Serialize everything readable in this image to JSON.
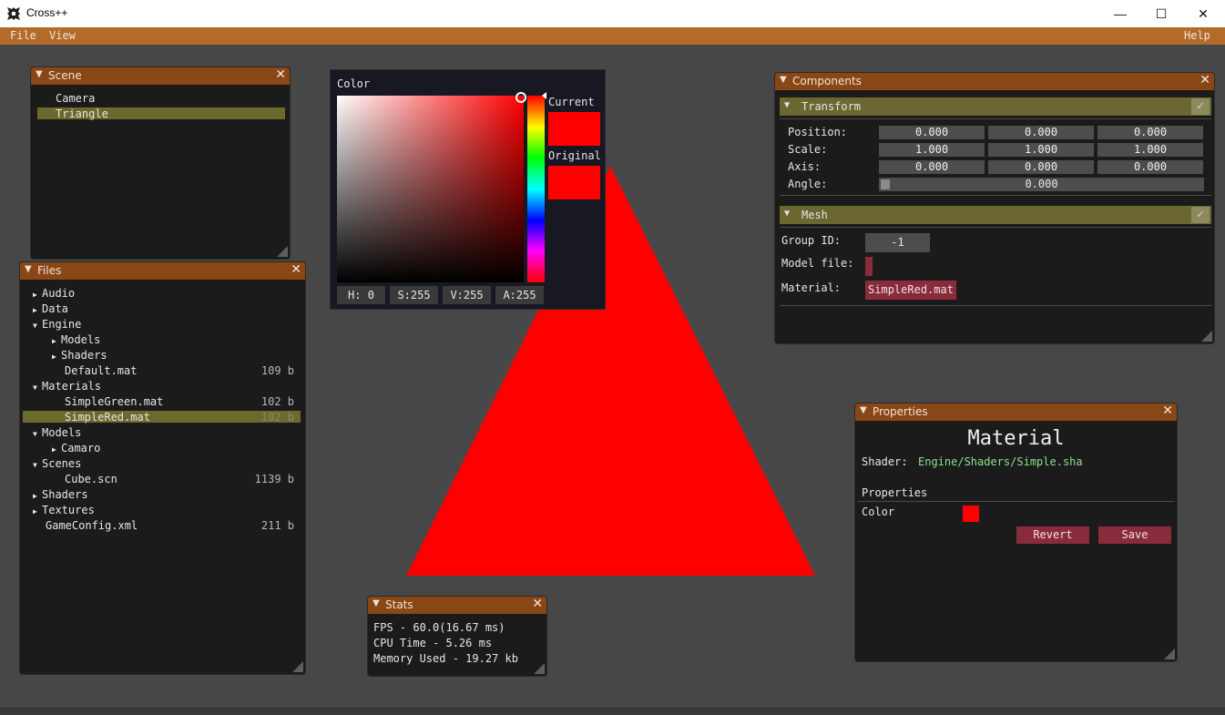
{
  "window": {
    "title": "Cross++",
    "controls": {
      "minimize": "—",
      "maximize": "☐",
      "close": "✕"
    }
  },
  "menubar": {
    "file": "File",
    "view": "View",
    "help": "Help"
  },
  "scene": {
    "title": "Scene",
    "items": [
      "Camera",
      "Triangle"
    ],
    "selected": "Triangle"
  },
  "files": {
    "title": "Files",
    "tree": [
      {
        "label": "Audio",
        "expanded": false,
        "indent": 0,
        "size": ""
      },
      {
        "label": "Data",
        "expanded": false,
        "indent": 0,
        "size": ""
      },
      {
        "label": "Engine",
        "expanded": true,
        "indent": 0,
        "size": ""
      },
      {
        "label": "Models",
        "expanded": false,
        "indent": 1,
        "size": ""
      },
      {
        "label": "Shaders",
        "expanded": false,
        "indent": 1,
        "size": ""
      },
      {
        "label": "Default.mat",
        "indent": 1,
        "size": "109 b"
      },
      {
        "label": "Materials",
        "expanded": true,
        "indent": 0,
        "size": ""
      },
      {
        "label": "SimpleGreen.mat",
        "indent": 1,
        "size": "102 b"
      },
      {
        "label": "SimpleRed.mat",
        "indent": 1,
        "size": "102 b",
        "selected": true
      },
      {
        "label": "Models",
        "expanded": true,
        "indent": 0,
        "size": ""
      },
      {
        "label": "Camaro",
        "expanded": false,
        "indent": 1,
        "size": ""
      },
      {
        "label": "Scenes",
        "expanded": true,
        "indent": 0,
        "size": ""
      },
      {
        "label": "Cube.scn",
        "indent": 1,
        "size": "1139 b"
      },
      {
        "label": "Shaders",
        "expanded": false,
        "indent": 0,
        "size": ""
      },
      {
        "label": "Textures",
        "expanded": false,
        "indent": 0,
        "size": ""
      },
      {
        "label": "GameConfig.xml",
        "indent": 0,
        "size": "211 b"
      }
    ]
  },
  "colorpicker": {
    "label": "Color",
    "current_label": "Current",
    "original_label": "Original",
    "current_color": "#ff0000",
    "original_color": "#ff0000",
    "h": "H:  0",
    "s": "S:255",
    "v": "V:255",
    "a": "A:255"
  },
  "viewport": {
    "triangle_color": "#ff0000"
  },
  "stats": {
    "title": "Stats",
    "fps": "FPS - 60.0(16.67 ms)",
    "cpu": "CPU Time - 5.26 ms",
    "memory": "Memory Used - 19.27 kb"
  },
  "components": {
    "title": "Components",
    "transform": {
      "title": "Transform",
      "position_label": "Position:",
      "scale_label": "Scale:",
      "axis_label": "Axis:",
      "angle_label": "Angle:",
      "position": [
        "0.000",
        "0.000",
        "0.000"
      ],
      "scale": [
        "1.000",
        "1.000",
        "1.000"
      ],
      "axis": [
        "0.000",
        "0.000",
        "0.000"
      ],
      "angle": "0.000"
    },
    "mesh": {
      "title": "Mesh",
      "group_id_label": "Group ID:",
      "group_id": "-1",
      "model_file_label": "Model file:",
      "material_label": "Material:",
      "material": "SimpleRed.mat"
    }
  },
  "properties": {
    "title": "Properties",
    "heading": "Material",
    "shader_label": "Shader:",
    "shader_value": "Engine/Shaders/Simple.sha",
    "section": "Properties",
    "color_label": "Color",
    "color_value": "#ff0000",
    "revert": "Revert",
    "save": "Save"
  }
}
